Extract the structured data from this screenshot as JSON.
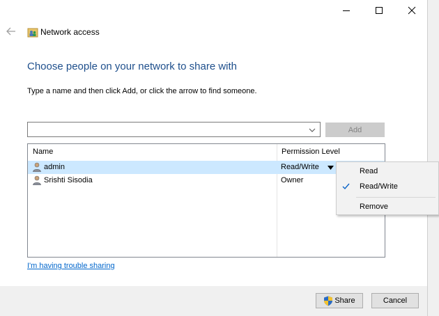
{
  "window": {
    "title": "Network access",
    "controls": [
      "minimize",
      "maximize",
      "close"
    ]
  },
  "main": {
    "heading": "Choose people on your network to share with",
    "instruction": "Type a name and then click Add, or click the arrow to find someone.",
    "name_input": {
      "value": "",
      "placeholder": ""
    },
    "add_label": "Add",
    "table": {
      "columns": [
        "Name",
        "Permission Level"
      ],
      "rows": [
        {
          "name": "admin",
          "permission": "Read/Write",
          "selected": true
        },
        {
          "name": "Srishti Sisodia",
          "permission": "Owner",
          "selected": false
        }
      ]
    },
    "help_link": "I'm having trouble sharing"
  },
  "permission_menu": {
    "items": [
      "Read",
      "Read/Write",
      "Remove"
    ],
    "checked": "Read/Write"
  },
  "footer": {
    "share_label": "Share",
    "cancel_label": "Cancel"
  },
  "colors": {
    "heading": "#1e4f8c",
    "selected_row": "#cce8ff",
    "link": "#0066cc",
    "check": "#0a64c8"
  }
}
